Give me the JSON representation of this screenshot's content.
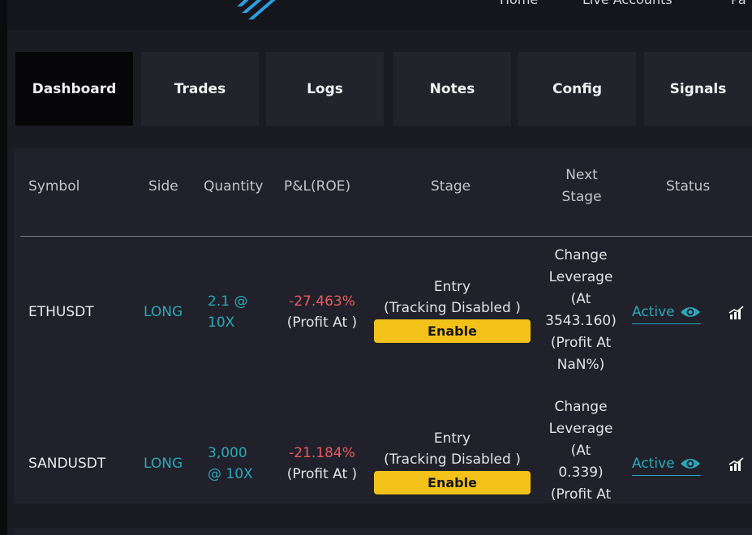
{
  "nav": {
    "links": [
      "Home",
      "Live Accounts",
      "Pa"
    ]
  },
  "tabs": [
    {
      "label": "Dashboard",
      "active": true
    },
    {
      "label": "Trades",
      "active": false
    },
    {
      "label": "Logs",
      "active": false
    },
    {
      "label": "Notes",
      "active": false
    },
    {
      "label": "Config",
      "active": false
    },
    {
      "label": "Signals",
      "active": false
    }
  ],
  "table": {
    "headers": {
      "symbol": "Symbol",
      "side": "Side",
      "quantity": "Quantity",
      "pnl": "P&L(ROE)",
      "stage": "Stage",
      "next_stage_1": "Next",
      "next_stage_2": "Stage",
      "status": "Status"
    },
    "rows": [
      {
        "symbol": "ETHUSDT",
        "side": "LONG",
        "qty_1": "2.1 @",
        "qty_2": "10X",
        "pnl": "-27.463%",
        "pnl_sub": "(Profit At )",
        "stage_1": "Entry",
        "stage_2": "(Tracking Disabled )",
        "enable": "Enable",
        "next_1": "Change",
        "next_2": "Leverage",
        "next_3": "(At",
        "next_4": "3543.160)",
        "next_5": "(Profit At",
        "next_6": "NaN%)",
        "status": "Active"
      },
      {
        "symbol": "SANDUSDT",
        "side": "LONG",
        "qty_1": "3,000",
        "qty_2": "@ 10X",
        "pnl": "-21.184%",
        "pnl_sub": "(Profit At )",
        "stage_1": "Entry",
        "stage_2": "(Tracking Disabled )",
        "enable": "Enable",
        "next_1": "Change",
        "next_2": "Leverage",
        "next_3": "(At",
        "next_4": "0.339)",
        "next_5": "(Profit At",
        "status": "Active"
      }
    ]
  },
  "colors": {
    "accent": "#2aa9bc",
    "negative": "#e85a60",
    "button": "#f3c21a",
    "background": "#1b1c23"
  }
}
